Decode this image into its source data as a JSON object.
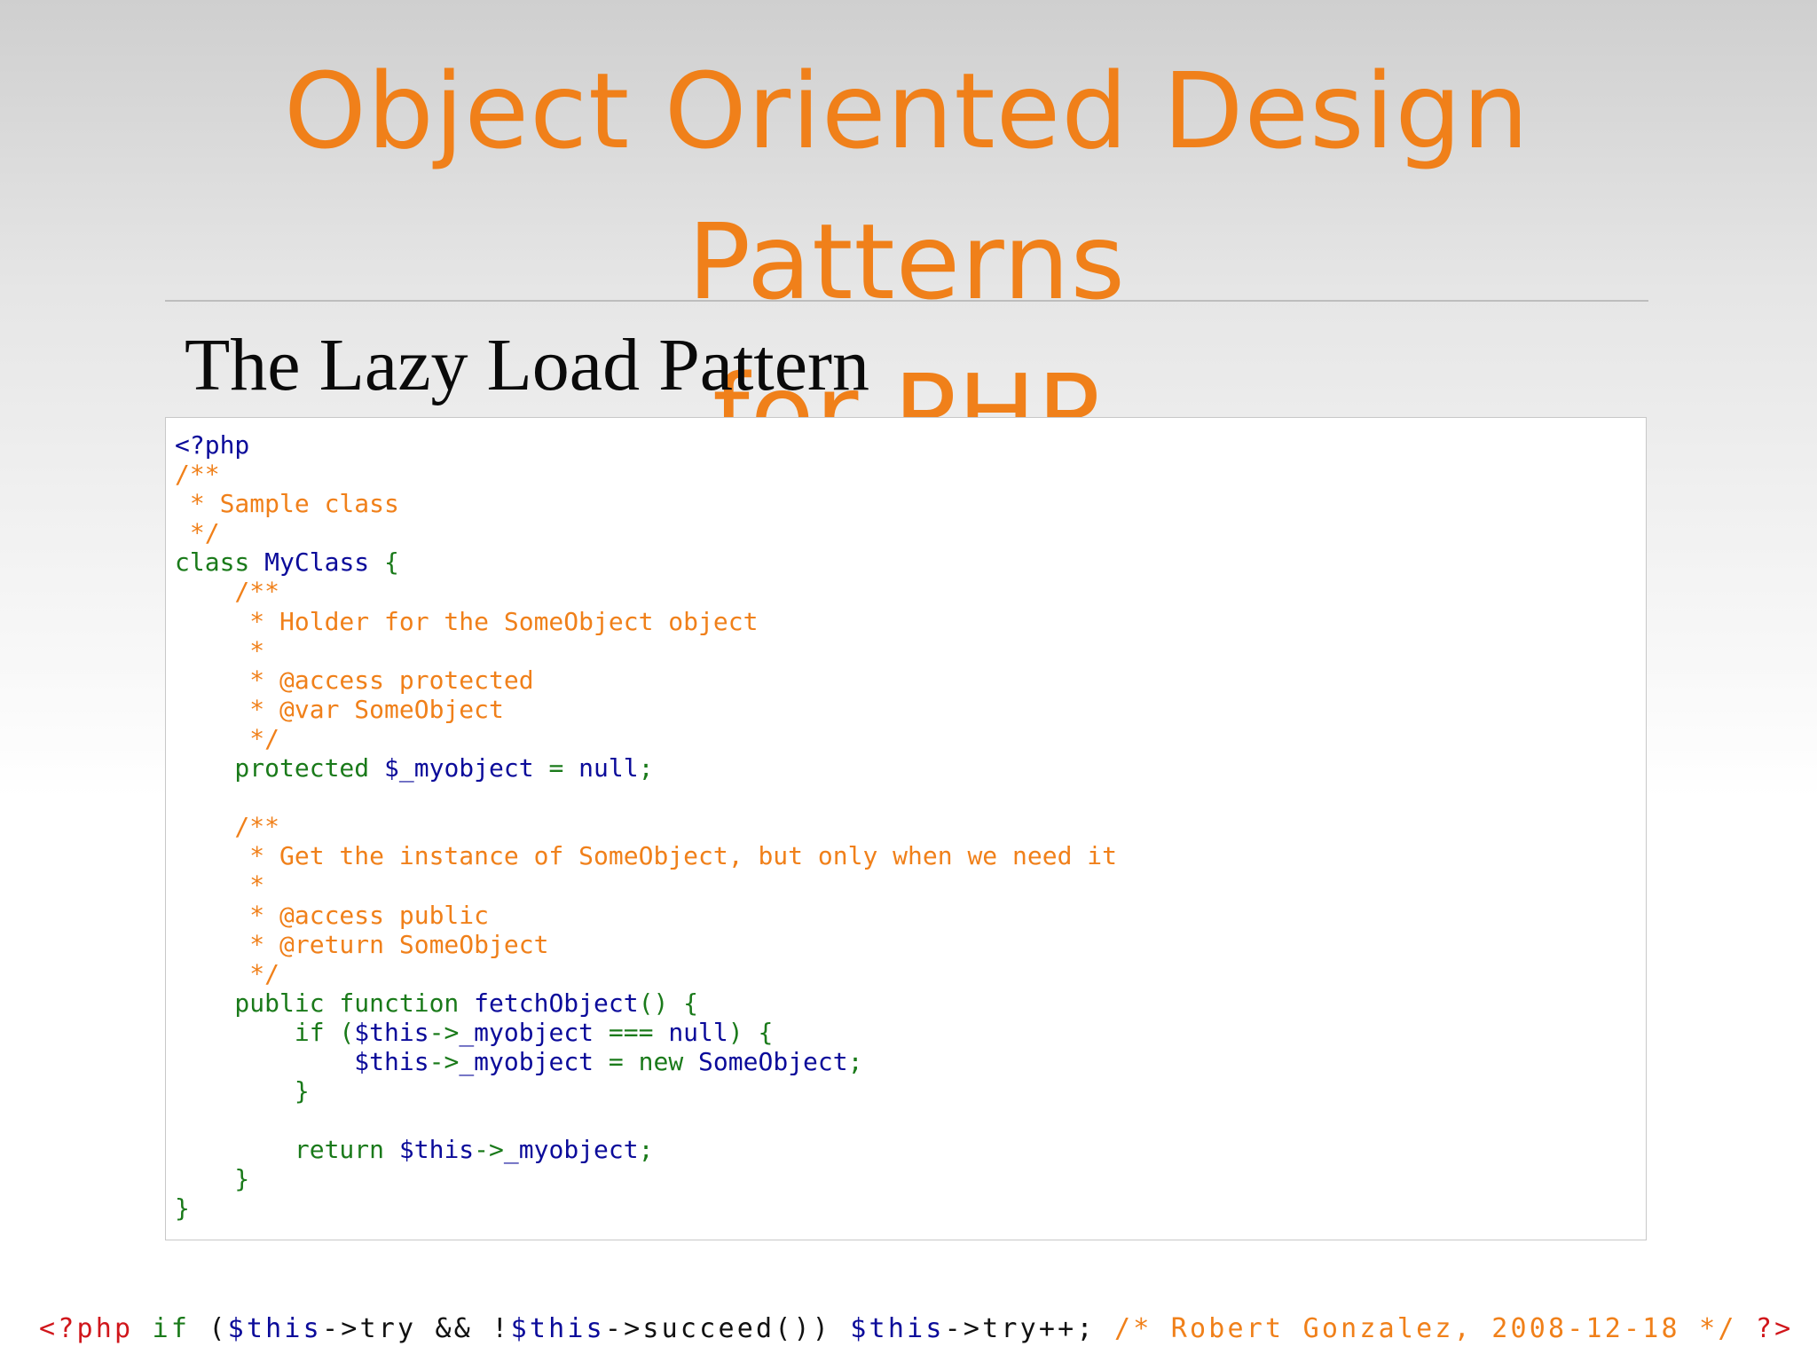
{
  "slide": {
    "title_line1": "Object Oriented Design Patterns",
    "title_line2": "for PHP",
    "subtitle": "The Lazy Load Pattern"
  },
  "code": {
    "lines": [
      [
        {
          "t": "<?php",
          "c": "blue"
        }
      ],
      [
        {
          "t": "/**",
          "c": "cm"
        }
      ],
      [
        {
          "t": " * Sample class",
          "c": "cm"
        }
      ],
      [
        {
          "t": " */",
          "c": "cm"
        }
      ],
      [
        {
          "t": "class ",
          "c": "kw"
        },
        {
          "t": "MyClass",
          "c": "blue"
        },
        {
          "t": " {",
          "c": "kw"
        }
      ],
      [
        {
          "t": "    /**",
          "c": "cm"
        }
      ],
      [
        {
          "t": "     * Holder for the SomeObject object",
          "c": "cm"
        }
      ],
      [
        {
          "t": "     *",
          "c": "cm"
        }
      ],
      [
        {
          "t": "     * @access protected",
          "c": "cm"
        }
      ],
      [
        {
          "t": "     * @var SomeObject",
          "c": "cm"
        }
      ],
      [
        {
          "t": "     */",
          "c": "cm"
        }
      ],
      [
        {
          "t": "    protected ",
          "c": "kw"
        },
        {
          "t": "$_myobject",
          "c": "blue"
        },
        {
          "t": " = ",
          "c": "kw"
        },
        {
          "t": "null",
          "c": "blue"
        },
        {
          "t": ";",
          "c": "kw"
        }
      ],
      [
        {
          "t": "",
          "c": "kw"
        }
      ],
      [
        {
          "t": "    /**",
          "c": "cm"
        }
      ],
      [
        {
          "t": "     * Get the instance of SomeObject, but only when we need it",
          "c": "cm"
        }
      ],
      [
        {
          "t": "     *",
          "c": "cm"
        }
      ],
      [
        {
          "t": "     * @access public",
          "c": "cm"
        }
      ],
      [
        {
          "t": "     * @return SomeObject",
          "c": "cm"
        }
      ],
      [
        {
          "t": "     */",
          "c": "cm"
        }
      ],
      [
        {
          "t": "    public function ",
          "c": "kw"
        },
        {
          "t": "fetchObject",
          "c": "blue"
        },
        {
          "t": "() {",
          "c": "kw"
        }
      ],
      [
        {
          "t": "        if (",
          "c": "kw"
        },
        {
          "t": "$this",
          "c": "blue"
        },
        {
          "t": "->",
          "c": "kw"
        },
        {
          "t": "_myobject",
          "c": "blue"
        },
        {
          "t": " === ",
          "c": "kw"
        },
        {
          "t": "null",
          "c": "blue"
        },
        {
          "t": ") {",
          "c": "kw"
        }
      ],
      [
        {
          "t": "            ",
          "c": "kw"
        },
        {
          "t": "$this",
          "c": "blue"
        },
        {
          "t": "->",
          "c": "kw"
        },
        {
          "t": "_myobject",
          "c": "blue"
        },
        {
          "t": " = new ",
          "c": "kw"
        },
        {
          "t": "SomeObject",
          "c": "blue"
        },
        {
          "t": ";",
          "c": "kw"
        }
      ],
      [
        {
          "t": "        }",
          "c": "kw"
        }
      ],
      [
        {
          "t": "",
          "c": "kw"
        }
      ],
      [
        {
          "t": "        return ",
          "c": "kw"
        },
        {
          "t": "$this",
          "c": "blue"
        },
        {
          "t": "->",
          "c": "kw"
        },
        {
          "t": "_myobject",
          "c": "blue"
        },
        {
          "t": ";",
          "c": "kw"
        }
      ],
      [
        {
          "t": "    }",
          "c": "kw"
        }
      ],
      [
        {
          "t": "}",
          "c": "kw"
        }
      ]
    ]
  },
  "footer": {
    "parts": [
      {
        "t": "<?php ",
        "c": "red"
      },
      {
        "t": "if ",
        "c": "green"
      },
      {
        "t": "(",
        "c": "dark"
      },
      {
        "t": "$this",
        "c": "blue"
      },
      {
        "t": "->try && !",
        "c": "dark"
      },
      {
        "t": "$this",
        "c": "blue"
      },
      {
        "t": "->succeed()) ",
        "c": "dark"
      },
      {
        "t": "$this",
        "c": "blue"
      },
      {
        "t": "->try++; ",
        "c": "dark"
      },
      {
        "t": "/* Robert Gonzalez, 2008-12-18 */ ",
        "c": "orange"
      },
      {
        "t": "?>",
        "c": "red"
      }
    ]
  },
  "colors": {
    "title": "#f0801a",
    "keyword": "#1a7a1a",
    "identifier": "#0b0b9a",
    "comment": "#f0801a",
    "php_tag": "#d0161b"
  }
}
